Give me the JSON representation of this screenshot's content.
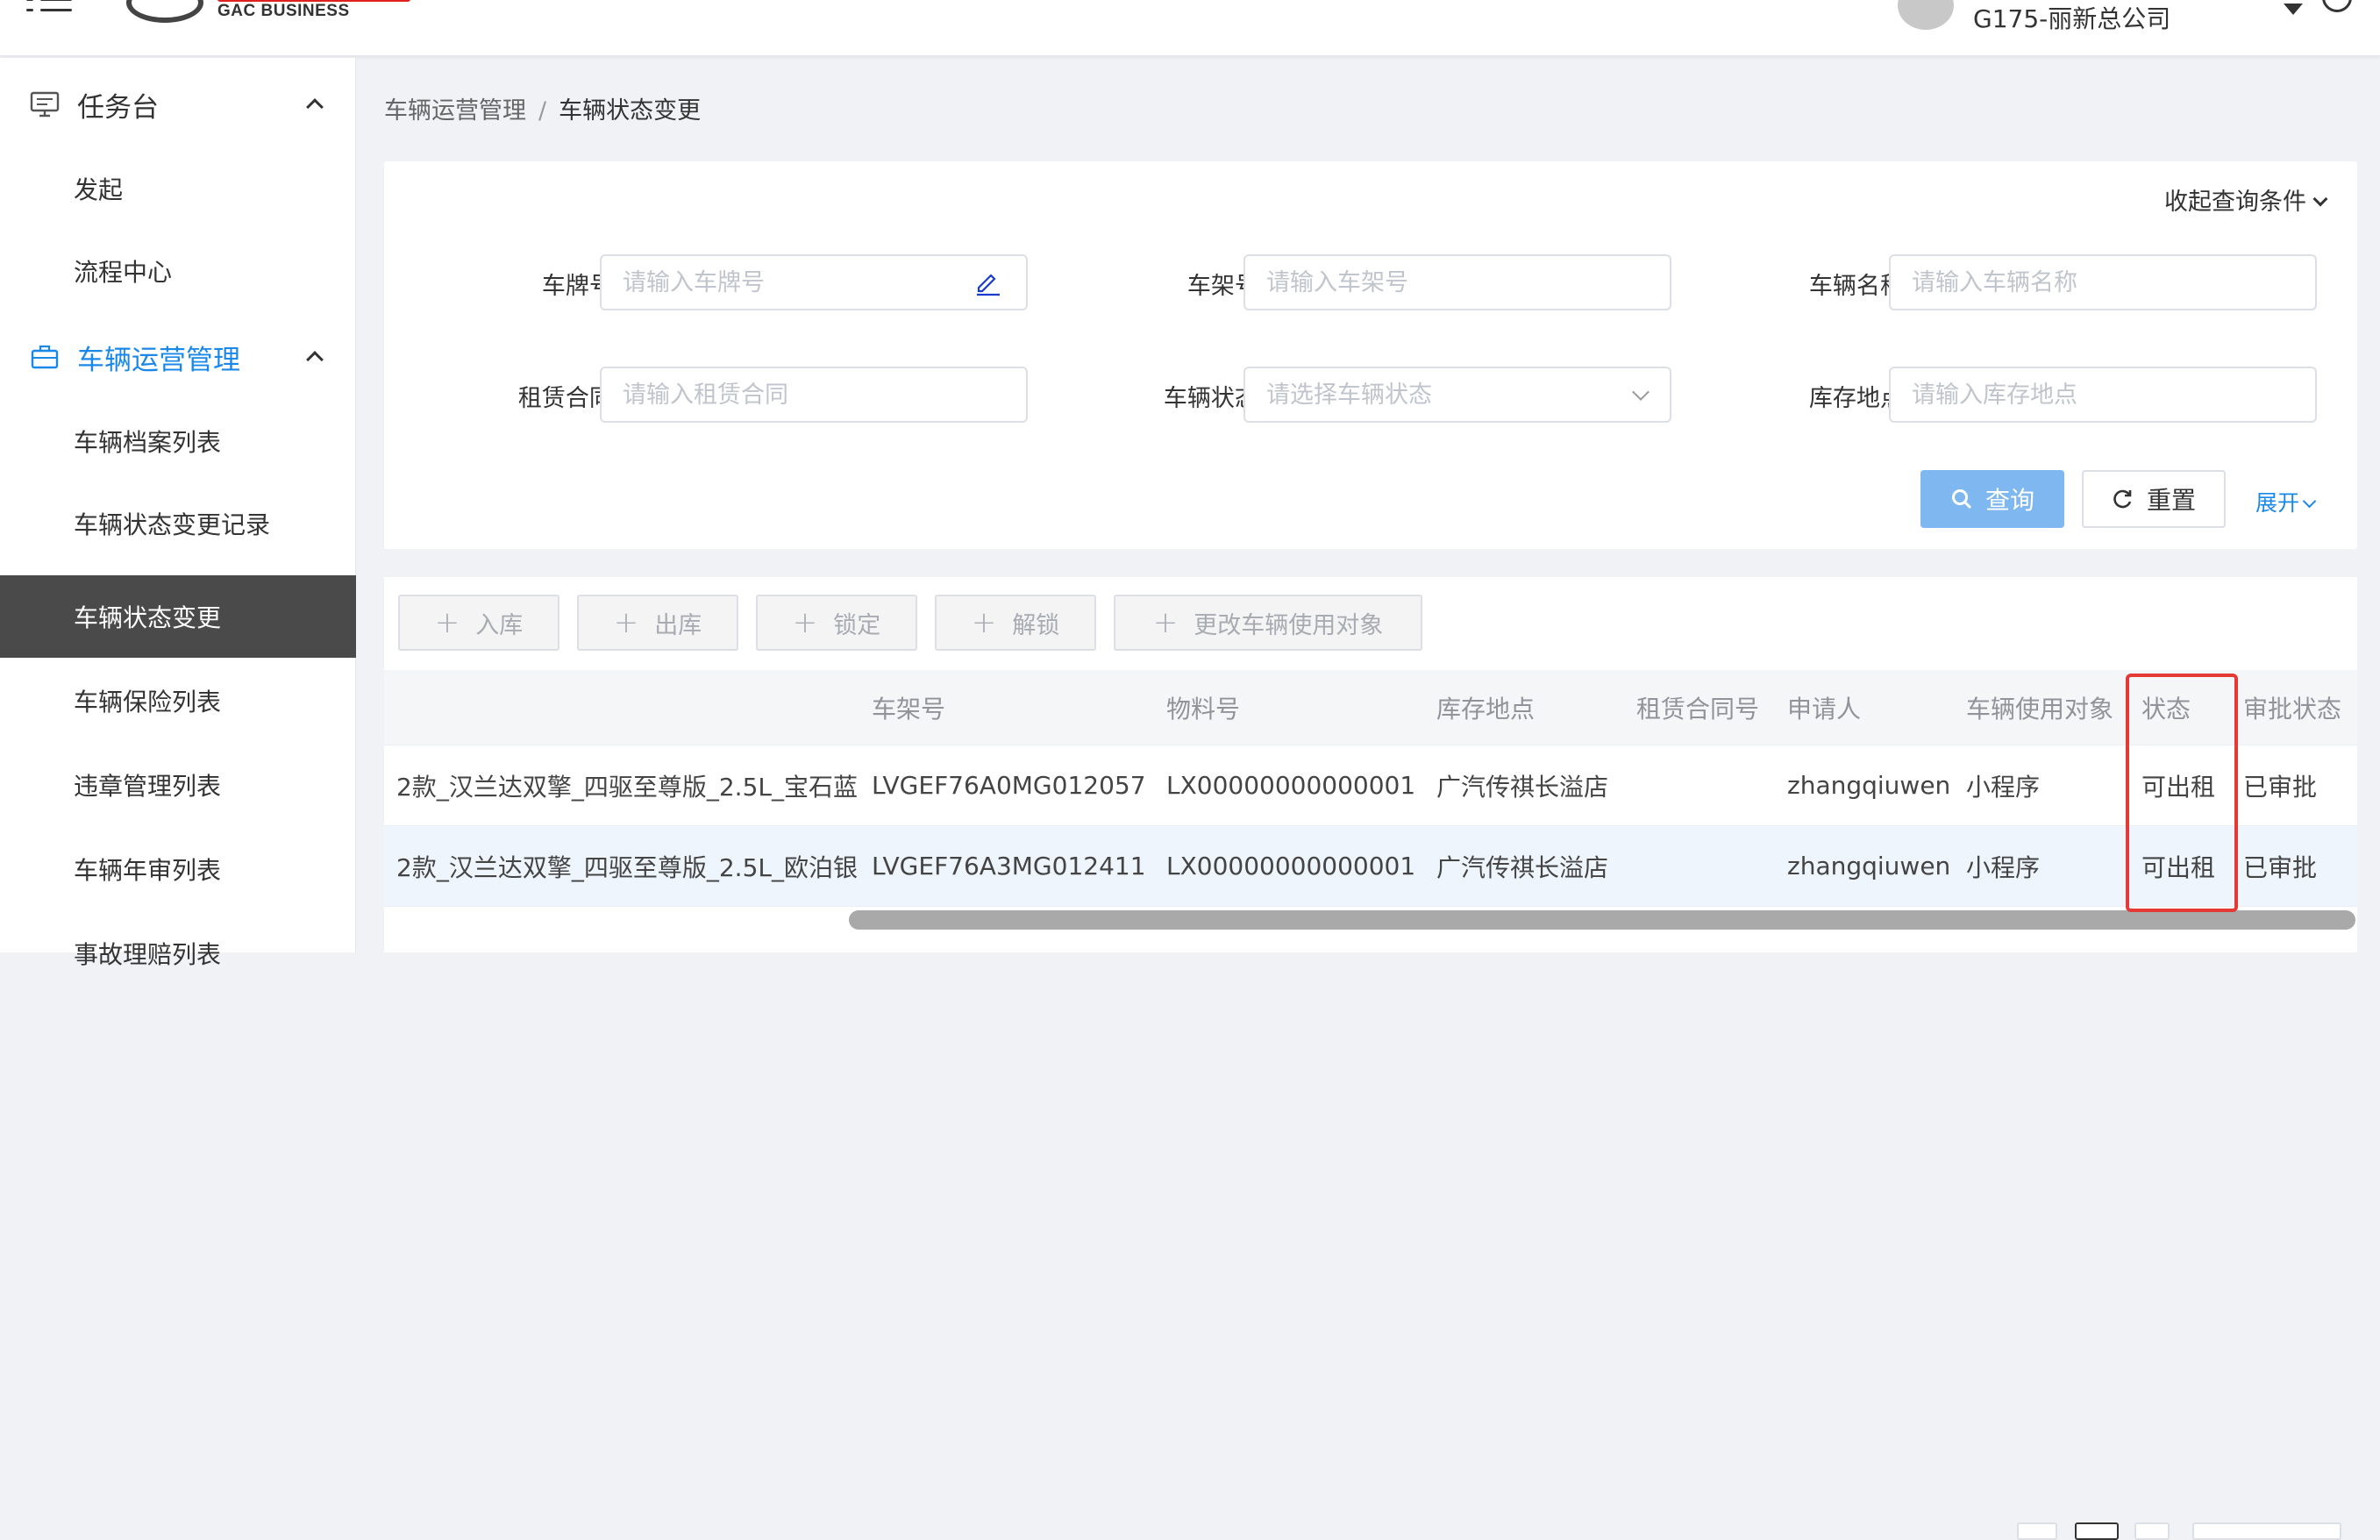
{
  "header": {
    "logo_text": "GAC BUSINESS",
    "company": "G175-丽新总公司"
  },
  "sidebar": {
    "groups": [
      {
        "label": "任务台",
        "icon": "monitor-icon"
      },
      {
        "label": "车辆运营管理",
        "icon": "briefcase-icon"
      }
    ],
    "items": [
      {
        "label": "发起"
      },
      {
        "label": "流程中心"
      },
      {
        "label": "车辆档案列表"
      },
      {
        "label": "车辆状态变更记录"
      },
      {
        "label": "车辆状态变更"
      },
      {
        "label": "车辆保险列表"
      },
      {
        "label": "违章管理列表"
      },
      {
        "label": "车辆年审列表"
      },
      {
        "label": "事故理赔列表"
      }
    ]
  },
  "breadcrumb": {
    "parent": "车辆运营管理",
    "separator": "/",
    "current": "车辆状态变更"
  },
  "query": {
    "collapse_label": "收起查询条件",
    "fields": [
      {
        "label": "车牌号:",
        "placeholder": "请输入车牌号"
      },
      {
        "label": "车架号:",
        "placeholder": "请输入车架号"
      },
      {
        "label": "车辆名称:",
        "placeholder": "请输入车辆名称"
      },
      {
        "label": "租赁合同:",
        "placeholder": "请输入租赁合同"
      },
      {
        "label": "车辆状态:",
        "placeholder": "请选择车辆状态"
      },
      {
        "label": "库存地点:",
        "placeholder": "请输入库存地点"
      }
    ],
    "search_label": "查询",
    "reset_label": "重置",
    "expand_label": "展开"
  },
  "toolbar": {
    "buttons": [
      "入库",
      "出库",
      "锁定",
      "解锁",
      "更改车辆使用对象"
    ]
  },
  "table": {
    "columns": [
      "车架号",
      "物料号",
      "库存地点",
      "租赁合同号",
      "申请人",
      "车辆使用对象",
      "状态",
      "审批状态"
    ],
    "rows": [
      {
        "name": "2款_汉兰达双擎_四驱至尊版_2.5L_宝石蓝",
        "vin": "LVGEF76A0MG012057",
        "material": "LX00000000000001",
        "location": "广汽传祺长溢店",
        "contract": "",
        "applicant": "zhangqiuwen",
        "target": "小程序",
        "status": "可出租",
        "approval": "已审批"
      },
      {
        "name": "2款_汉兰达双擎_四驱至尊版_2.5L_欧泊银",
        "vin": "LVGEF76A3MG012411",
        "material": "LX00000000000001",
        "location": "广汽传祺长溢店",
        "contract": "",
        "applicant": "zhangqiuwen",
        "target": "小程序",
        "status": "可出租",
        "approval": "已审批"
      }
    ]
  },
  "colors": {
    "accent": "#1a88e8",
    "primary_button": "#7fb8f0",
    "selected_menu": "#4a4a4a",
    "highlight": "#e53935"
  }
}
